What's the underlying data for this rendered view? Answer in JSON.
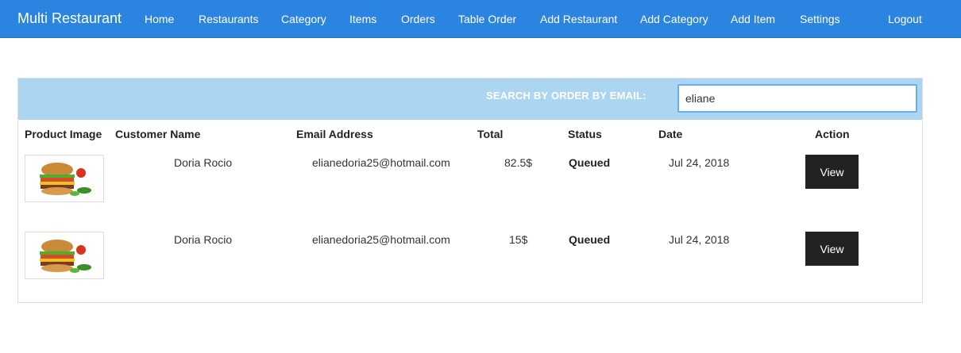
{
  "navbar": {
    "brand": "Multi Restaurant",
    "links": [
      "Home",
      "Restaurants",
      "Category",
      "Items",
      "Orders",
      "Table Order",
      "Add Restaurant",
      "Add Category",
      "Add Item",
      "Settings"
    ],
    "logout": "Logout"
  },
  "search": {
    "label": "SEARCH BY ORDER BY EMAIL:",
    "value": "eliane"
  },
  "table": {
    "headers": [
      "Product Image",
      "Customer Name",
      "Email Address",
      "Total",
      "Status",
      "Date",
      "Action"
    ],
    "rows": [
      {
        "image": "burger-image",
        "customer": "Doria Rocio",
        "email": "elianedoria25@hotmail.com",
        "total": "82.5$",
        "status": "Queued",
        "date": "Jul 24, 2018",
        "action": "View"
      },
      {
        "image": "burger-image",
        "customer": "Doria Rocio",
        "email": "elianedoria25@hotmail.com",
        "total": "15$",
        "status": "Queued",
        "date": "Jul 24, 2018",
        "action": "View"
      }
    ]
  },
  "colors": {
    "navbar": "#2b84e0",
    "search_bar": "#acd5f1",
    "button": "#222222"
  }
}
